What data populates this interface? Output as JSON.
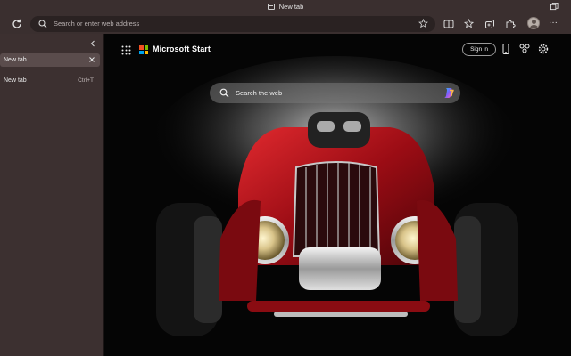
{
  "window": {
    "title": "New tab"
  },
  "toolbar": {
    "address_placeholder": "Search or enter web address"
  },
  "sidebar": {
    "tabs": [
      {
        "label": "New tab",
        "active": true
      },
      {
        "label": "New tab",
        "shortcut": "Ctrl+T"
      }
    ]
  },
  "newtab": {
    "brand": "Microsoft Start",
    "signin": "Sign in",
    "search_placeholder": "Search the web"
  },
  "colors": {
    "accent_red": "#b0101a",
    "content_bg": "#050505",
    "chrome_bg": "#3a2f2f"
  },
  "icons": [
    "tab-icon",
    "restore-icon",
    "refresh-icon",
    "search-icon",
    "star-icon",
    "split-screen-icon",
    "favorites-icon",
    "collections-icon",
    "extensions-icon",
    "more-icon",
    "chevron-left-icon",
    "close-icon",
    "apps-grid-icon",
    "phone-icon",
    "rewards-icon",
    "settings-icon",
    "copilot-icon"
  ]
}
